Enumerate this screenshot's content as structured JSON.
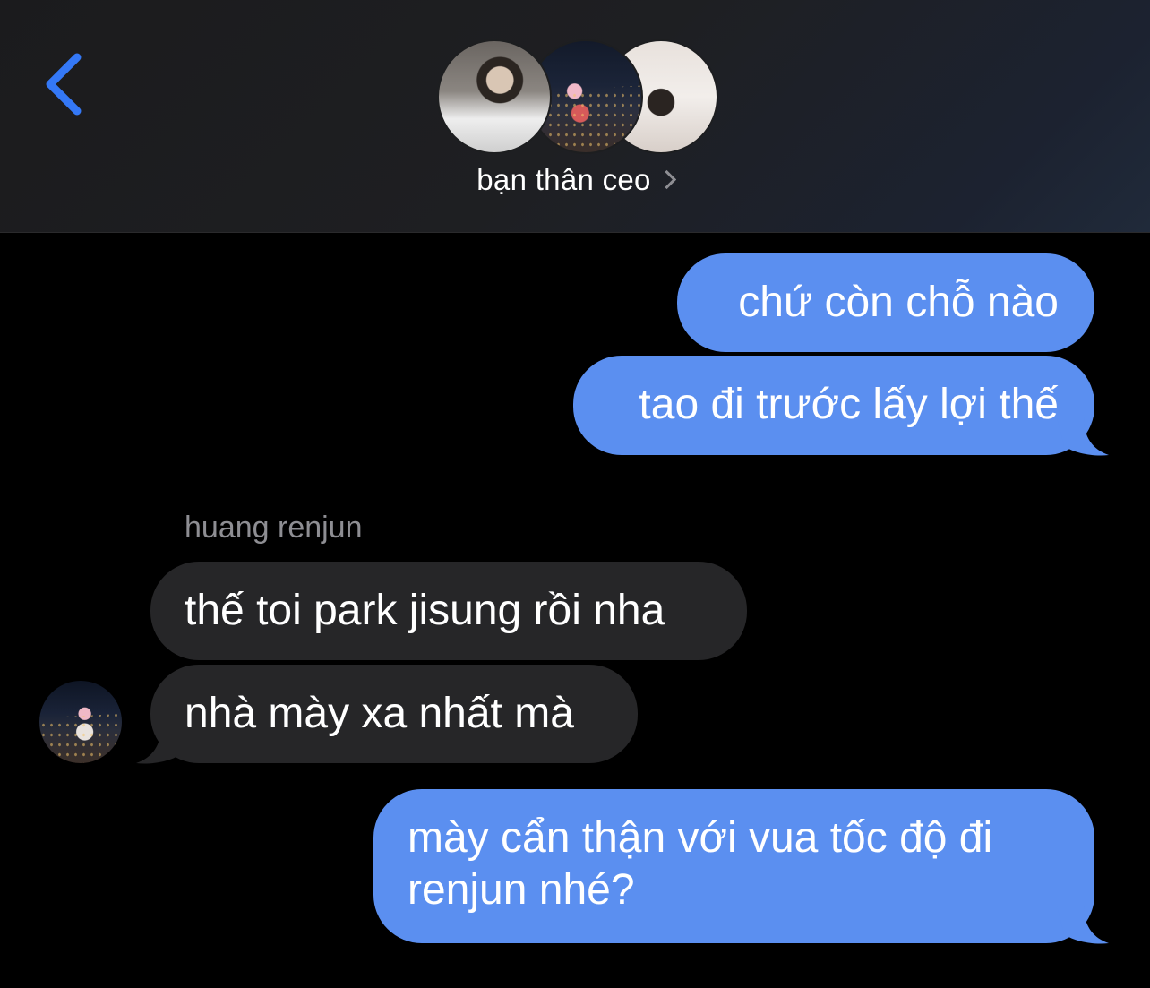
{
  "header": {
    "group_name": "bạn thân ceo",
    "back_icon": "chevron-left-icon",
    "detail_icon": "chevron-right-icon",
    "accent_color": "#3478f6"
  },
  "messages": [
    {
      "direction": "outgoing",
      "text": "chứ còn chỗ nào"
    },
    {
      "direction": "outgoing",
      "text": "tao đi trước lấy lợi thế"
    },
    {
      "direction": "incoming",
      "sender": "huang renjun",
      "text": "thế toi park jisung rồi nha"
    },
    {
      "direction": "incoming",
      "sender": "huang renjun",
      "text": "nhà mày xa nhất mà"
    },
    {
      "direction": "outgoing",
      "text": "mày cẩn thận với vua tốc độ đi renjun nhé?"
    }
  ],
  "colors": {
    "outgoing_bubble": "#5b8ff0",
    "incoming_bubble": "#262628",
    "background": "#000000",
    "sender_name": "#8e8e93"
  }
}
